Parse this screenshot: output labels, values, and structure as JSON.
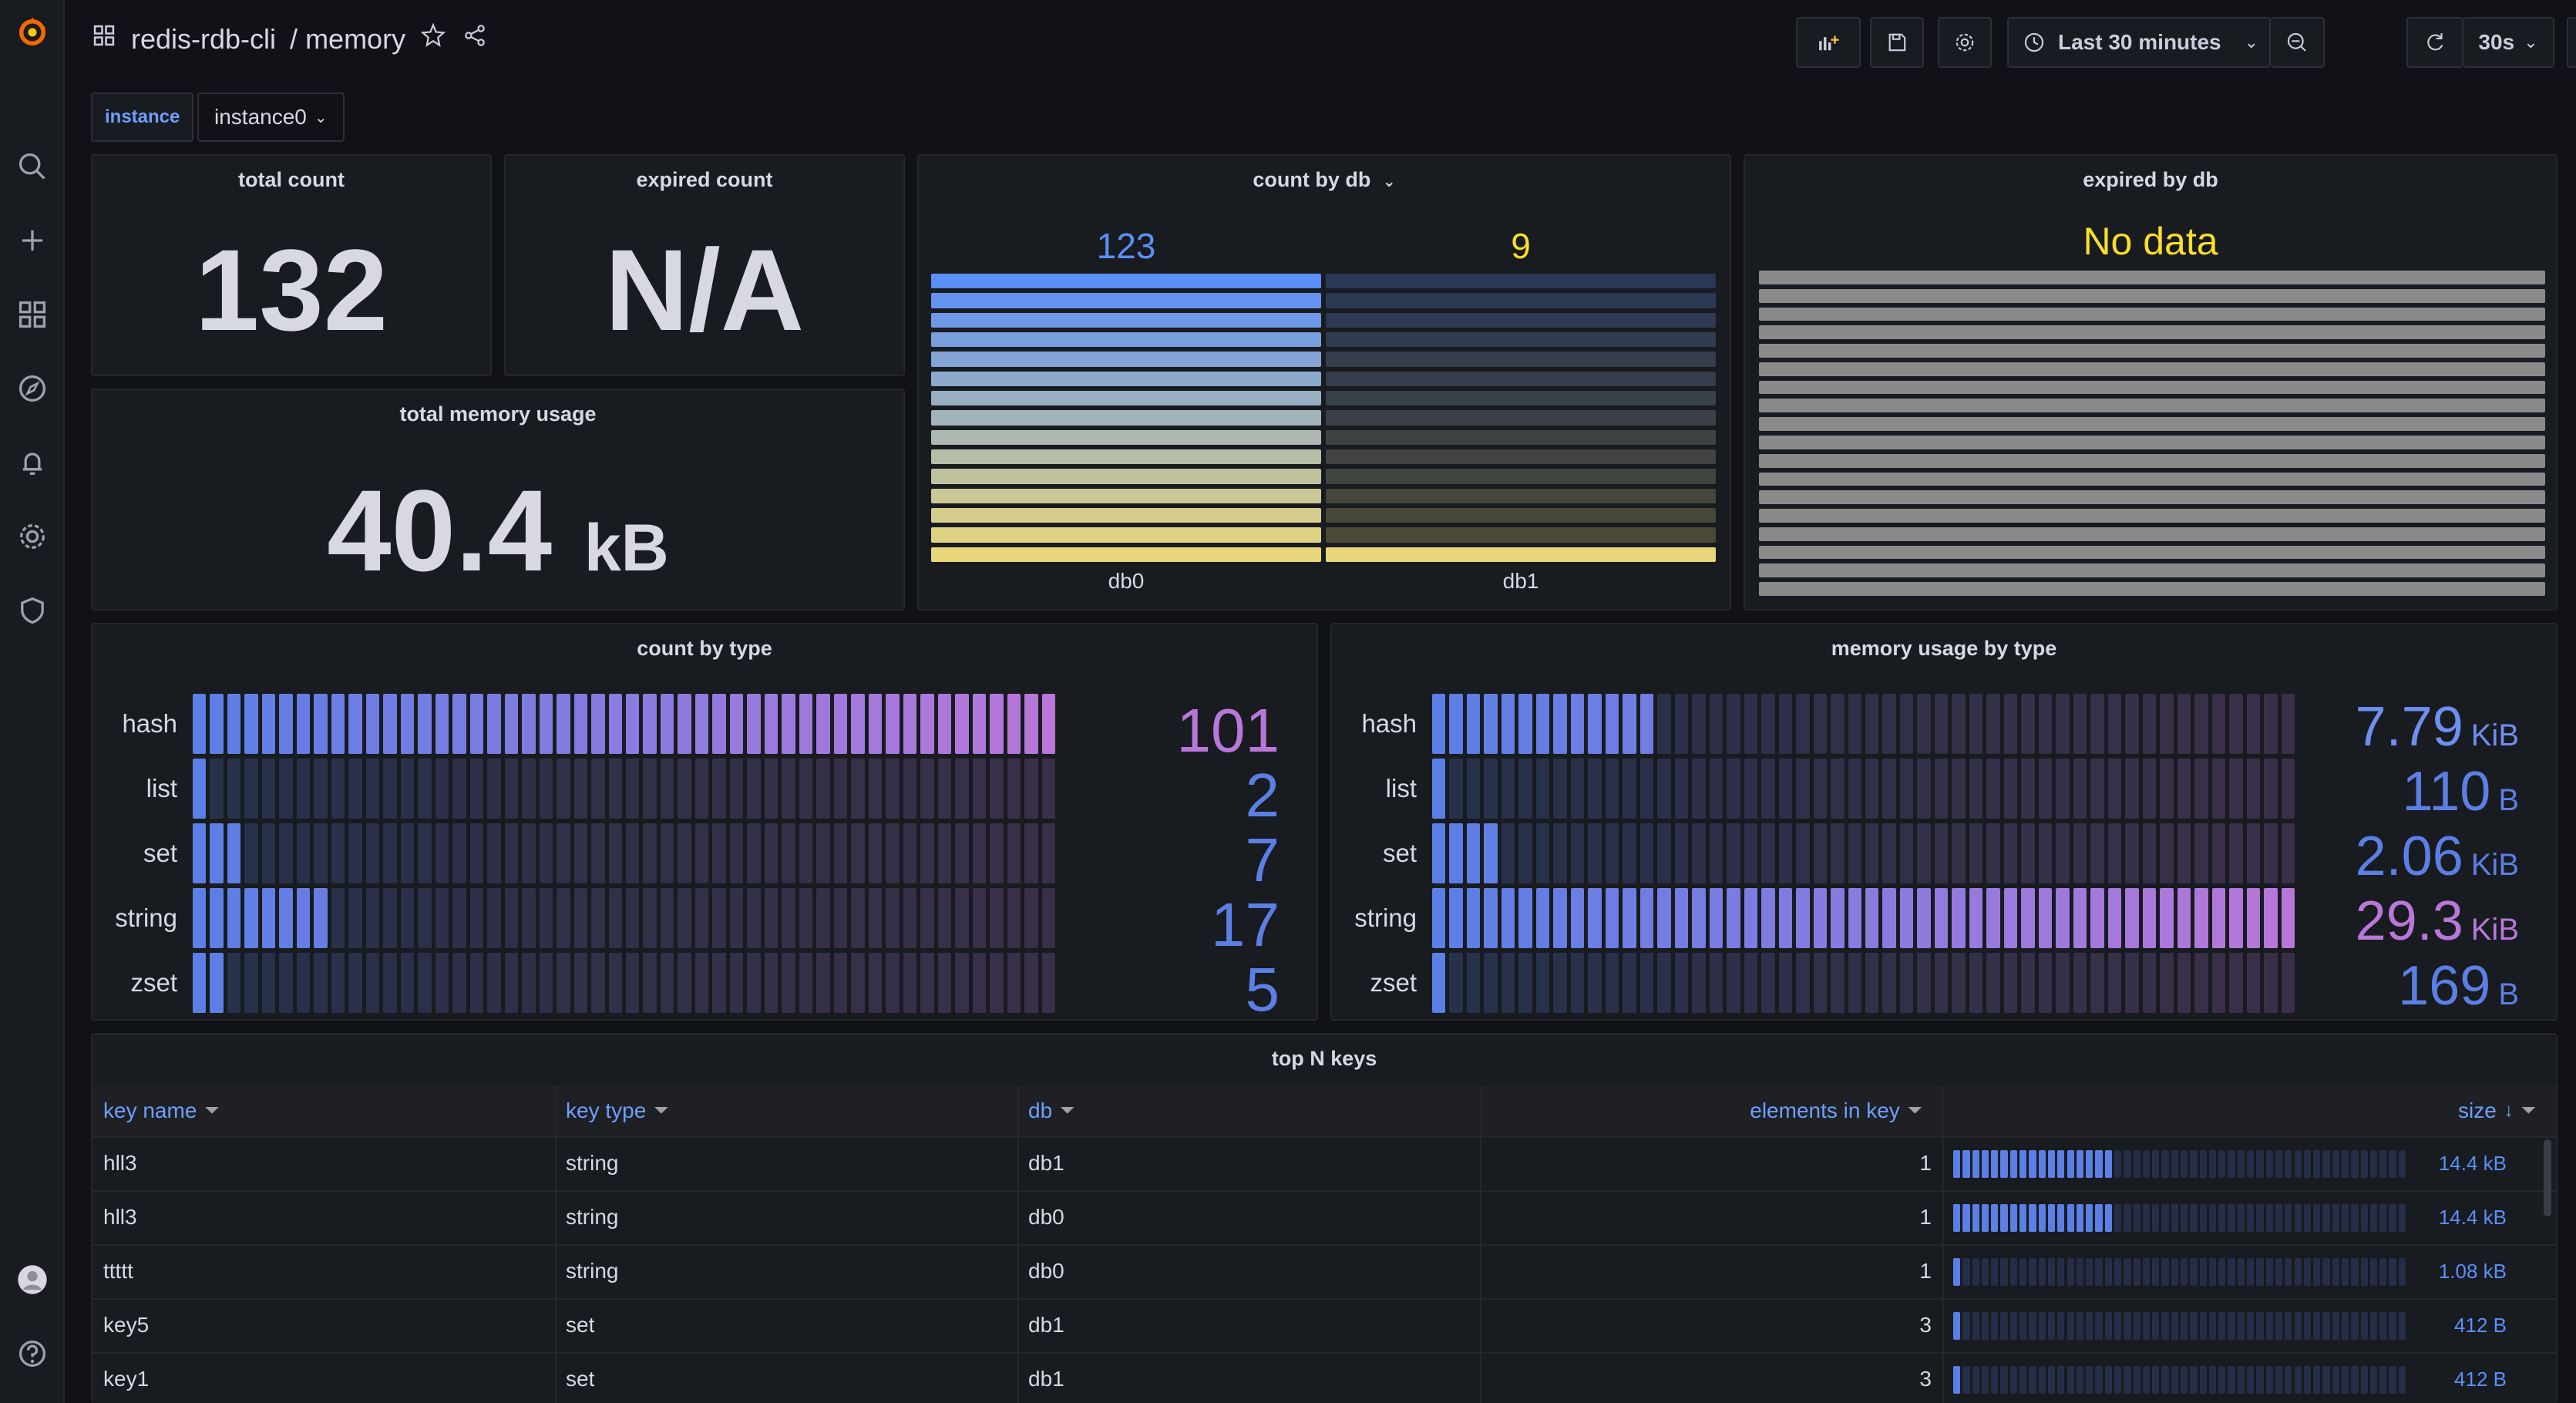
{
  "breadcrumb": {
    "folder": "redis-rdb-cli",
    "separator": "/",
    "dashboard": "memory"
  },
  "toolbar": {
    "time_range": "Last 30 minutes",
    "refresh_interval": "30s"
  },
  "variable": {
    "label": "instance",
    "value": "instance0"
  },
  "panels": {
    "total_count": {
      "title": "total count",
      "value": "132"
    },
    "expired_count": {
      "title": "expired count",
      "value": "N/A"
    },
    "total_memory": {
      "title": "total memory usage",
      "value": "40.4",
      "unit": "kB"
    },
    "count_by_db": {
      "title": "count by db",
      "items": [
        {
          "label": "db0",
          "value": "123",
          "raw": 123,
          "color": "#5b8ff9"
        },
        {
          "label": "db1",
          "value": "9",
          "raw": 9,
          "color": "#fade2a"
        }
      ],
      "max": 132
    },
    "expired_by_db": {
      "title": "expired by db",
      "no_data": "No data"
    },
    "count_by_type": {
      "title": "count by type",
      "max": 101,
      "rows": [
        {
          "label": "hash",
          "value": "101",
          "raw": 101,
          "unit": "",
          "color": "#b877d9"
        },
        {
          "label": "list",
          "value": "2",
          "raw": 2,
          "unit": "",
          "color": "#5b7fe5"
        },
        {
          "label": "set",
          "value": "7",
          "raw": 7,
          "unit": "",
          "color": "#5b7fe5"
        },
        {
          "label": "string",
          "value": "17",
          "raw": 17,
          "unit": "",
          "color": "#5b7fe5"
        },
        {
          "label": "zset",
          "value": "5",
          "raw": 5,
          "unit": "",
          "color": "#5b7fe5"
        }
      ]
    },
    "memory_by_type": {
      "title": "memory usage by type",
      "max": 30003,
      "rows": [
        {
          "label": "hash",
          "value": "7.79",
          "raw": 7977,
          "unit": "KiB",
          "color": "#6e8ff0"
        },
        {
          "label": "list",
          "value": "110",
          "raw": 110,
          "unit": "B",
          "color": "#5b7fe5"
        },
        {
          "label": "set",
          "value": "2.06",
          "raw": 2109,
          "unit": "KiB",
          "color": "#5b7fe5"
        },
        {
          "label": "string",
          "value": "29.3",
          "raw": 30003,
          "unit": "KiB",
          "color": "#b877d9"
        },
        {
          "label": "zset",
          "value": "169",
          "raw": 169,
          "unit": "B",
          "color": "#5b7fe5"
        }
      ]
    }
  },
  "table": {
    "title": "top N keys",
    "columns": [
      "key name",
      "key type",
      "db",
      "elements in key",
      "size"
    ],
    "rows": [
      {
        "name": "hll3",
        "type": "string",
        "db": "db1",
        "elements": "1",
        "size": "14.4 kB",
        "fraction": 1.0
      },
      {
        "name": "hll3",
        "type": "string",
        "db": "db0",
        "elements": "1",
        "size": "14.4 kB",
        "fraction": 1.0
      },
      {
        "name": "ttttt",
        "type": "string",
        "db": "db0",
        "elements": "1",
        "size": "1.08 kB",
        "fraction": 0.075
      },
      {
        "name": "key5",
        "type": "set",
        "db": "db1",
        "elements": "3",
        "size": "412 B",
        "fraction": 0.029
      },
      {
        "name": "key1",
        "type": "set",
        "db": "db1",
        "elements": "3",
        "size": "412 B",
        "fraction": 0.029
      }
    ],
    "bar_max_fraction": 0.32
  }
}
